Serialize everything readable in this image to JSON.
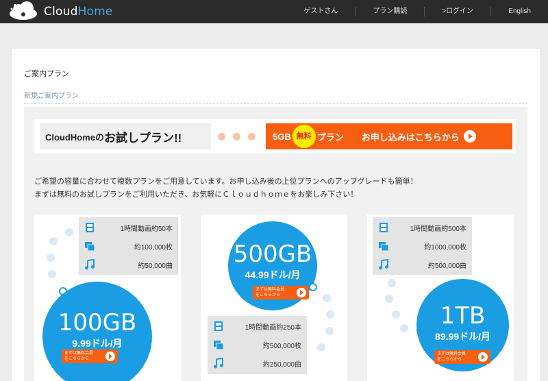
{
  "header": {
    "logo_prefix": "Cloud",
    "logo_suffix": "Home",
    "nav": [
      "ゲストさん",
      "プラン購読",
      ">ログイン",
      "English"
    ]
  },
  "page": {
    "title": "ご案内プラン",
    "breadcrumb": "新規ご案内プラン"
  },
  "banner": {
    "left_small": "CloudHomeの",
    "left_big": "お試しプラン!!",
    "gb": "5GB",
    "free_badge": "無料",
    "plan": "プラン",
    "apply": "お申し込みはこちらから"
  },
  "description": {
    "line1": "ご希望の容量に合わせて複数プランをご用意しています。お申し込み後の上位プランへのアップグレードも簡単！",
    "line2": "まずは無料のお試しプランをご利用いただき、お気軽にＣｌｏｕｄｈｏｍｅをお楽しみ下さい！"
  },
  "plans": [
    {
      "size": "100GB",
      "price": "9.99ドル/月",
      "video": "1時間動画約50本",
      "photos": "約100,000枚",
      "songs": "約50,000曲",
      "btn_line1": "まずは無料会員",
      "btn_line2": "をこちらから"
    },
    {
      "size": "500GB",
      "price": "44.99ドル/月",
      "video": "1時間動画約250本",
      "photos": "約500,000枚",
      "songs": "約250,000曲",
      "btn_line1": "まずは無料会員",
      "btn_line2": "をこちらから"
    },
    {
      "size": "1TB",
      "price": "89.99ドル/月",
      "video": "1時間動画約500本",
      "photos": "約1000,000枚",
      "songs": "約500,000曲",
      "btn_line1": "まずは無料会員",
      "btn_line2": "をこちらから"
    }
  ],
  "icons": {
    "video": "film-icon",
    "photos": "photos-icon",
    "music": "music-note-icon"
  },
  "colors": {
    "accent_blue": "#1b9de3",
    "orange": "#f65f12",
    "topbar": "#2b2b2b"
  }
}
